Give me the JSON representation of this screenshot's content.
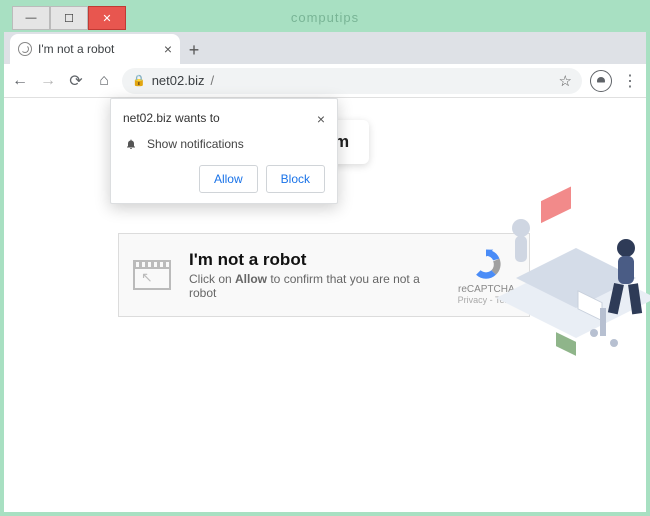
{
  "watermark": "computips",
  "tab": {
    "title": "I'm not a robot"
  },
  "omnibox": {
    "domain": "net02.biz",
    "rest": "/"
  },
  "confirm_button": "to confirm",
  "notification": {
    "title": "net02.biz wants to",
    "permission": "Show notifications",
    "allow": "Allow",
    "block": "Block"
  },
  "captcha": {
    "title": "I'm not a robot",
    "sub_pre": "Click on ",
    "sub_bold": "Allow",
    "sub_post": " to confirm that you are not a robot",
    "brand": "reCAPTCHA",
    "legal": "Privacy - Term"
  }
}
